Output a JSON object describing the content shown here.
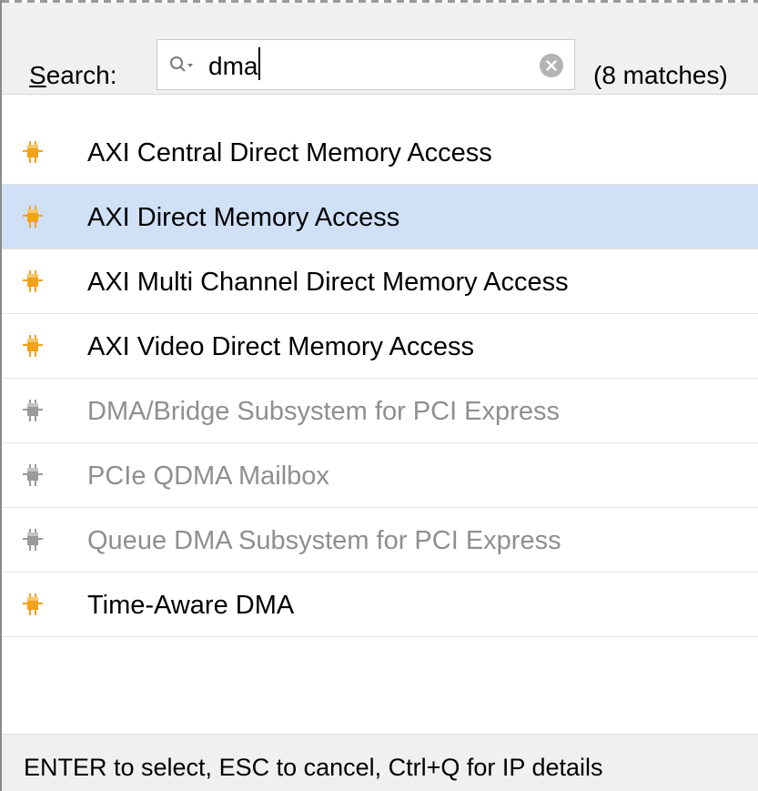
{
  "search": {
    "label_mnemonic": "S",
    "label_rest": "earch:",
    "value": "dma",
    "match_count": "(8 matches)"
  },
  "results": [
    {
      "label": "AXI Central Direct Memory Access",
      "enabled": true,
      "selected": false
    },
    {
      "label": "AXI Direct Memory Access",
      "enabled": true,
      "selected": true
    },
    {
      "label": "AXI Multi Channel Direct Memory Access",
      "enabled": true,
      "selected": false
    },
    {
      "label": "AXI Video Direct Memory Access",
      "enabled": true,
      "selected": false
    },
    {
      "label": "DMA/Bridge Subsystem for PCI Express",
      "enabled": false,
      "selected": false
    },
    {
      "label": "PCIe QDMA Mailbox",
      "enabled": false,
      "selected": false
    },
    {
      "label": "Queue DMA Subsystem for PCI Express",
      "enabled": false,
      "selected": false
    },
    {
      "label": "Time-Aware DMA",
      "enabled": true,
      "selected": false
    }
  ],
  "footer": {
    "hint": "ENTER to select, ESC to cancel, Ctrl+Q for IP details"
  },
  "colors": {
    "selected_row": "#cfe0f7",
    "ip_icon_enabled": "#f2a21a",
    "ip_icon_disabled": "#9a9a9a",
    "disabled_text": "#8f8f8f"
  },
  "icons": {
    "search": "magnifier-dropdown-icon",
    "clear": "clear-search-icon",
    "ip": "ip-core-icon"
  }
}
